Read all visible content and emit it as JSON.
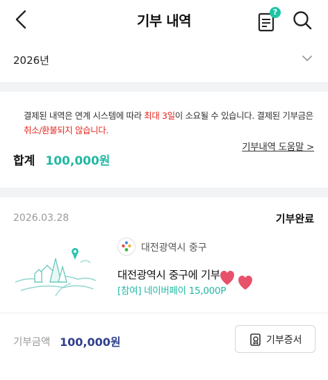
{
  "header": {
    "title": "기부 내역",
    "back_icon": "chevron-left-icon",
    "help_icon": "document-help-icon",
    "help_badge": "?",
    "search_icon": "search-icon"
  },
  "year_selector": {
    "value": "2026년"
  },
  "notice": {
    "part1": "결제된 내역은 연계 시스템에 따라 ",
    "highlight1": "최대 3일",
    "part2": "이 소요될 수 있습니다. 결제된 기부금은 ",
    "highlight2": "취소/환불되지 않습니다."
  },
  "help_link": "기부내역 도움말 >",
  "total": {
    "label": "합계",
    "value": "100,000원"
  },
  "donation": {
    "date": "2026.03.28",
    "status": "기부완료",
    "org_name": "대전광역시 중구",
    "title": "대전광역시 중구에 기부",
    "payment": "[참여] 네이버페이 15,000P"
  },
  "amount": {
    "label": "기부금액",
    "value": "100,000원"
  },
  "certificate_button": {
    "label": "기부증서"
  },
  "colors": {
    "accent": "#21b8a4",
    "warning": "#e3271e",
    "amount": "#2f3f8c",
    "heart": "#e8516a"
  }
}
